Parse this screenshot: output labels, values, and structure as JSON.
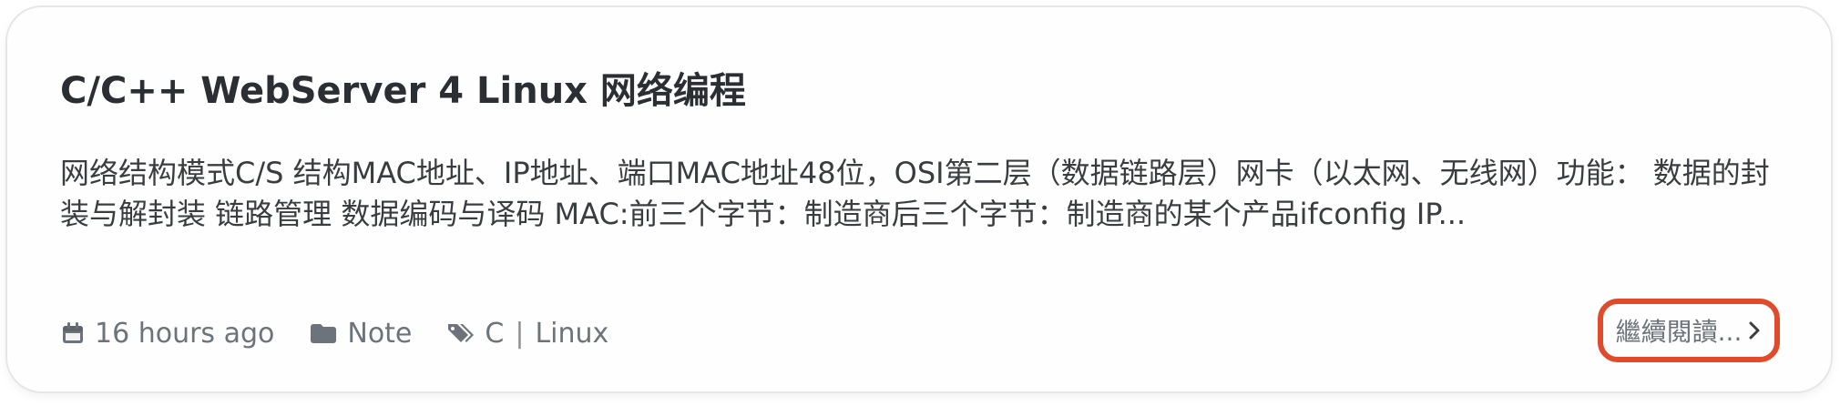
{
  "post": {
    "title": "C/C++ WebServer 4 Linux 网络编程",
    "excerpt": "网络结构模式C/S 结构MAC地址、IP地址、端口MAC地址48位，OSI第二层（数据链路层）网卡（以太网、无线网）功能： 数据的封装与解封装 链路管理 数据编码与译码 MAC:前三个字节：制造商后三个字节：制造商的某个产品ifconfig IP...",
    "meta": {
      "date_icon": "calendar-icon",
      "date": "16 hours ago",
      "category_icon": "folder-icon",
      "category": "Note",
      "tags_icon": "tags-icon",
      "tags": [
        "C",
        "Linux"
      ],
      "tag_separator": "|"
    },
    "read_more": {
      "label": "繼續閱讀...",
      "icon": "chevron-right-icon"
    }
  },
  "colors": {
    "title": "#2b2f33",
    "text": "#3a3d40",
    "meta": "#6c737a",
    "highlight_border": "#e14a2b",
    "card_border": "#e6e6e6"
  }
}
